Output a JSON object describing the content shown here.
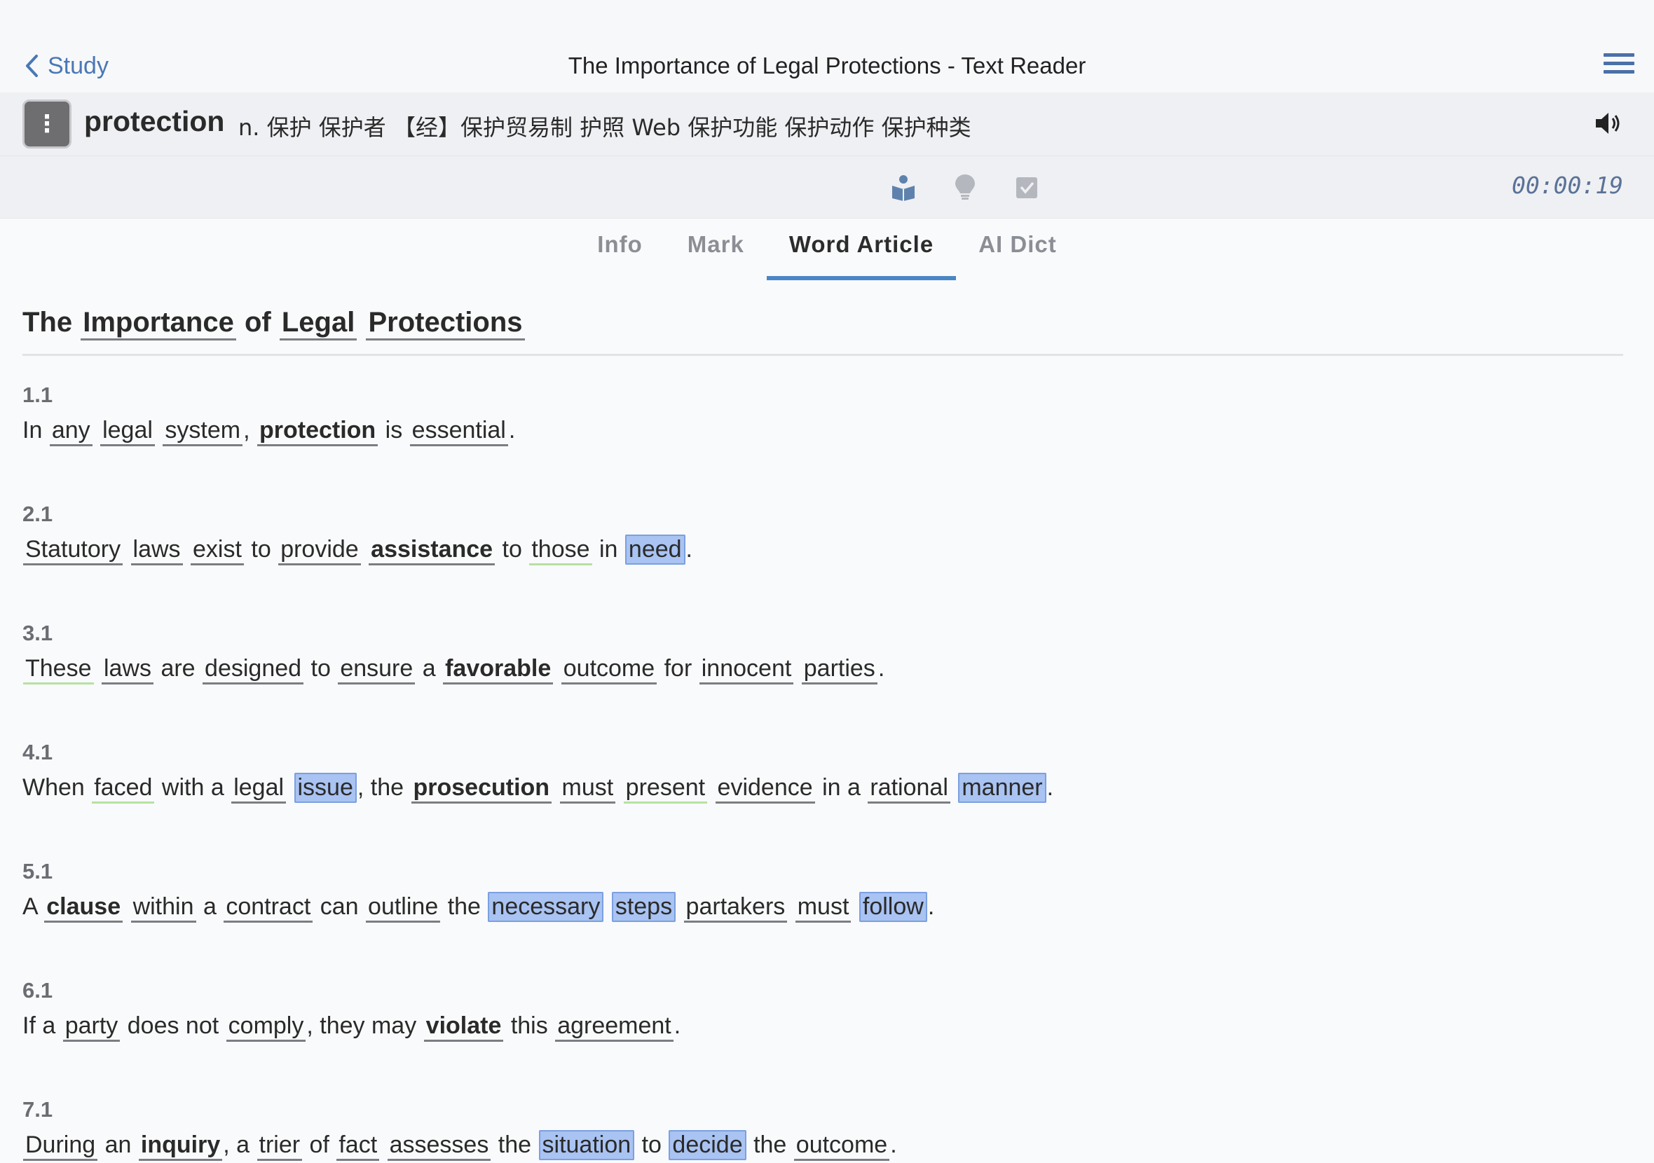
{
  "header": {
    "back_label": "Study",
    "title": "The Importance of Legal Protections - Text Reader"
  },
  "word": {
    "headword": "protection",
    "definition": "n. 保护 保护者 【经】保护贸易制 护照 Web 保护功能 保护动作 保护种类"
  },
  "toolbar": {
    "timer": "00:00:19"
  },
  "tabs": [
    {
      "label": "Info"
    },
    {
      "label": "Mark"
    },
    {
      "label": "Word Article"
    },
    {
      "label": "AI Dict"
    }
  ],
  "article": {
    "title_words": [
      "The",
      "Importance",
      "of",
      "Legal",
      "Protections"
    ],
    "paragraphs": [
      {
        "num": "1.1",
        "tokens": [
          [
            "In",
            "p"
          ],
          [
            "any",
            "w"
          ],
          [
            "legal",
            "w"
          ],
          [
            "system",
            "w"
          ],
          [
            ",",
            "x"
          ],
          [
            "protection",
            "b"
          ],
          [
            "is",
            "p"
          ],
          [
            "essential",
            "w"
          ],
          [
            ".",
            "x"
          ]
        ]
      },
      {
        "num": "2.1",
        "tokens": [
          [
            "Statutory",
            "w"
          ],
          [
            "laws",
            "w"
          ],
          [
            "exist",
            "w"
          ],
          [
            "to",
            "p"
          ],
          [
            "provide",
            "w"
          ],
          [
            "assistance",
            "b"
          ],
          [
            "to",
            "p"
          ],
          [
            "those",
            "g"
          ],
          [
            "in",
            "p"
          ],
          [
            "need",
            "h"
          ],
          [
            ".",
            "x"
          ]
        ]
      },
      {
        "num": "3.1",
        "tokens": [
          [
            "These",
            "g"
          ],
          [
            "laws",
            "w"
          ],
          [
            "are",
            "p"
          ],
          [
            "designed",
            "w"
          ],
          [
            "to",
            "p"
          ],
          [
            "ensure",
            "w"
          ],
          [
            "a",
            "p"
          ],
          [
            "favorable",
            "b"
          ],
          [
            "outcome",
            "w"
          ],
          [
            "for",
            "p"
          ],
          [
            "innocent",
            "w"
          ],
          [
            "parties",
            "w"
          ],
          [
            ".",
            "x"
          ]
        ]
      },
      {
        "num": "4.1",
        "tokens": [
          [
            "When",
            "p"
          ],
          [
            "faced",
            "g"
          ],
          [
            "with a",
            "p"
          ],
          [
            "legal",
            "w"
          ],
          [
            "issue",
            "h"
          ],
          [
            ", the",
            "x"
          ],
          [
            "prosecution",
            "b"
          ],
          [
            "must",
            "w"
          ],
          [
            "present",
            "g"
          ],
          [
            "evidence",
            "w"
          ],
          [
            "in a",
            "p"
          ],
          [
            "rational",
            "w"
          ],
          [
            "manner",
            "h"
          ],
          [
            ".",
            "x"
          ]
        ]
      },
      {
        "num": "5.1",
        "tokens": [
          [
            "A",
            "p"
          ],
          [
            "clause",
            "b"
          ],
          [
            "within",
            "w"
          ],
          [
            "a",
            "p"
          ],
          [
            "contract",
            "w"
          ],
          [
            "can",
            "p"
          ],
          [
            "outline",
            "w"
          ],
          [
            "the",
            "p"
          ],
          [
            "necessary",
            "h"
          ],
          [
            "steps",
            "h"
          ],
          [
            "partakers",
            "w"
          ],
          [
            "must",
            "w"
          ],
          [
            "follow",
            "h"
          ],
          [
            ".",
            "x"
          ]
        ]
      },
      {
        "num": "6.1",
        "tokens": [
          [
            "If a",
            "p"
          ],
          [
            "party",
            "w"
          ],
          [
            "does not",
            "p"
          ],
          [
            "comply",
            "w"
          ],
          [
            ", they may",
            "x"
          ],
          [
            "violate",
            "b"
          ],
          [
            "this",
            "p"
          ],
          [
            "agreement",
            "w"
          ],
          [
            ".",
            "x"
          ]
        ]
      },
      {
        "num": "7.1",
        "tokens": [
          [
            "During",
            "w"
          ],
          [
            "an",
            "p"
          ],
          [
            "inquiry",
            "b"
          ],
          [
            ", a",
            "x"
          ],
          [
            "trier",
            "w"
          ],
          [
            "of",
            "p"
          ],
          [
            "fact",
            "w"
          ],
          [
            "assesses",
            "w"
          ],
          [
            "the",
            "p"
          ],
          [
            "situation",
            "h"
          ],
          [
            "to",
            "p"
          ],
          [
            "decide",
            "h"
          ],
          [
            "the",
            "p"
          ],
          [
            "outcome",
            "w"
          ],
          [
            ".",
            "x"
          ]
        ]
      }
    ]
  }
}
